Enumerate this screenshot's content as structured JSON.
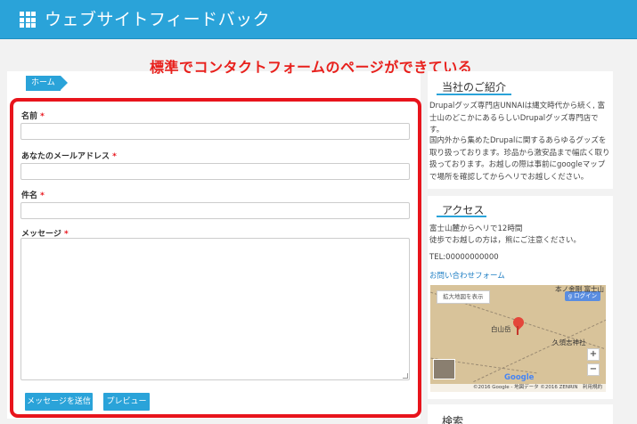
{
  "header": {
    "title": "ウェブサイトフィードバック",
    "menu_icon": "grid-icon"
  },
  "annotation": "標準でコンタクトフォームのページができている",
  "breadcrumb": {
    "home": "ホーム"
  },
  "form": {
    "name_label": "名前",
    "email_label": "あなたのメールアドレス",
    "subject_label": "件名",
    "message_label": "メッセージ",
    "required_mark": "*",
    "name_value": "",
    "email_value": "",
    "subject_value": "",
    "message_value": "",
    "submit_label": "メッセージを送信",
    "preview_label": "プレビュー"
  },
  "sidebar": {
    "about": {
      "title": "当社のご紹介",
      "p1": "Drupalグッズ専門店UNNAIは縄文時代から続く, 富士山のどこかにあるらしいDrupalグッズ専門店です。",
      "p2": "国内外から集めたDrupalに関するあらゆるグッズを取り扱っております。珍品から激安品まで幅広く取り扱っております。お越しの際は事前にgoogleマップで場所を確認してからヘリでお越しください。"
    },
    "access": {
      "title": "アクセス",
      "line1": "富士山麓からヘリで12時間",
      "line2": "徒歩でお越しの方は，熊にご注意ください。",
      "tel": "TEL:00000000000",
      "contact_link": "お問い合わせフォーム"
    },
    "map": {
      "enlarge": "拡大地図を表示",
      "login": "ログイン",
      "place1": "白山岳",
      "place2": "久須志神社",
      "place3": "本ノ金剛 富士山",
      "zoom_in": "+",
      "zoom_out": "−",
      "google": "Google",
      "copyright": "©2016 Google - 地図データ ©2016 ZENRIN　利用規約"
    },
    "search": {
      "title": "検索"
    }
  },
  "colors": {
    "brand": "#2aa3d9",
    "highlight": "#e8141c"
  }
}
